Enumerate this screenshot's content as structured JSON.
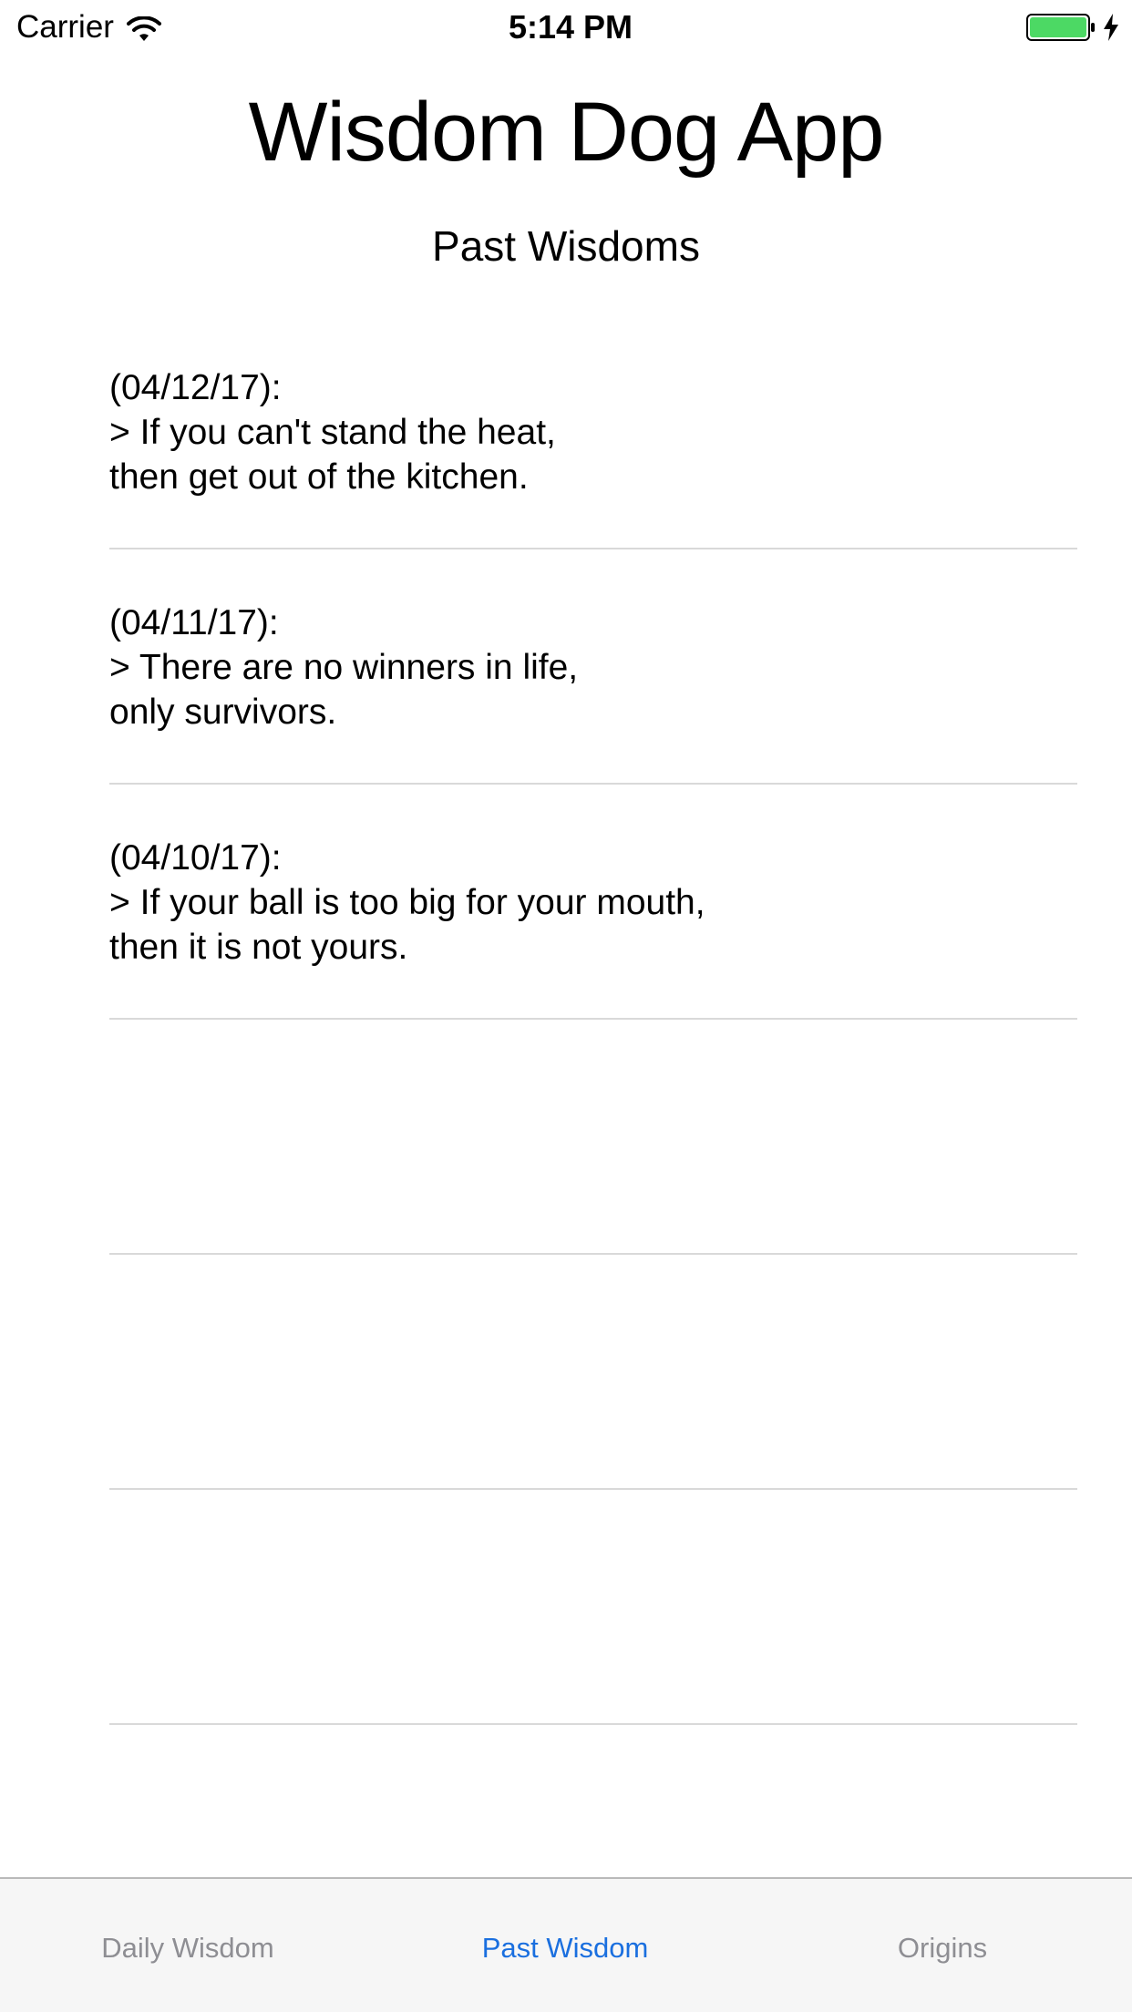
{
  "status_bar": {
    "carrier": "Carrier",
    "time": "5:14 PM",
    "battery_color": "#4cd964"
  },
  "header": {
    "app_title": "Wisdom Dog App",
    "section_title": "Past Wisdoms"
  },
  "wisdoms": [
    {
      "date": "(04/12/17):",
      "line1": "> If you can't stand the heat,",
      "line2": "then get out of the kitchen."
    },
    {
      "date": "(04/11/17):",
      "line1": "> There are no winners in life,",
      "line2": "only survivors."
    },
    {
      "date": "(04/10/17):",
      "line1": "> If your ball is too big for your mouth,",
      "line2": "then it is not yours."
    }
  ],
  "tab_bar": {
    "tabs": [
      {
        "label": "Daily Wisdom",
        "active": false
      },
      {
        "label": "Past Wisdom",
        "active": true
      },
      {
        "label": "Origins",
        "active": false
      }
    ],
    "active_color": "#1a6fdf",
    "inactive_color": "#8e8e93"
  }
}
